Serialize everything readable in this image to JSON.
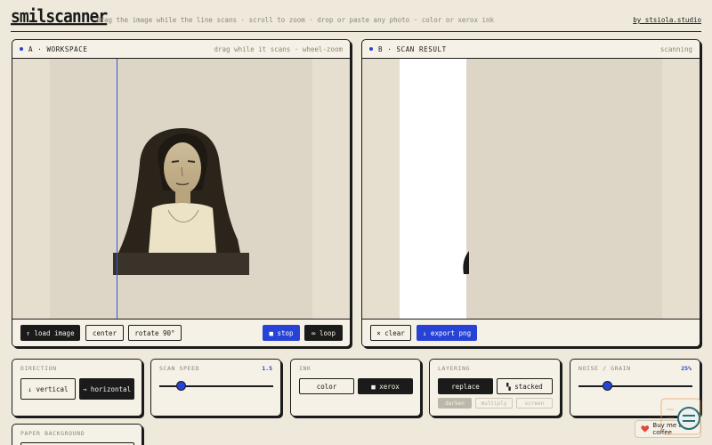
{
  "header": {
    "logo": "smilscanner",
    "tagline": "drag the image while the line scans · scroll to zoom · drop or paste any photo · color or xerox ink",
    "credit": "by stsiola.studio"
  },
  "workspace": {
    "title": "A · WORKSPACE",
    "hint": "drag while it scans · wheel-zoom",
    "buttons": {
      "load": "↑ load image",
      "center": "center",
      "rotate": "rotate 90°",
      "stop": "■ stop",
      "loop": "∞ loop"
    }
  },
  "result": {
    "title": "B · SCAN RESULT",
    "status": "scanning",
    "buttons": {
      "clear": "× clear",
      "export": "↓ export png"
    }
  },
  "controls": {
    "direction": {
      "label": "DIRECTION",
      "vertical": "↓ vertical",
      "horizontal": "→ horizontal",
      "selected": "horizontal"
    },
    "speed": {
      "label": "SCAN SPEED",
      "value": "1.5"
    },
    "ink": {
      "label": "INK",
      "color": "color",
      "xerox": "■ xerox",
      "selected": "xerox"
    },
    "layering": {
      "label": "LAYERING",
      "replace": "replace",
      "stacked": "▚ stacked",
      "darken": "darken",
      "multiply": "multiply",
      "screen": "screen",
      "selected": "replace"
    },
    "noise": {
      "label": "NOISE / GRAIN",
      "value": "25%"
    },
    "paper": {
      "label": "PAPER BACKGROUND"
    }
  },
  "support": {
    "label": "Buy me a coffee"
  },
  "colors": {
    "accent": "#2743d6",
    "ink": "#1b1b1b",
    "paper": "#f6f1e6",
    "background": "#efe9dc"
  }
}
